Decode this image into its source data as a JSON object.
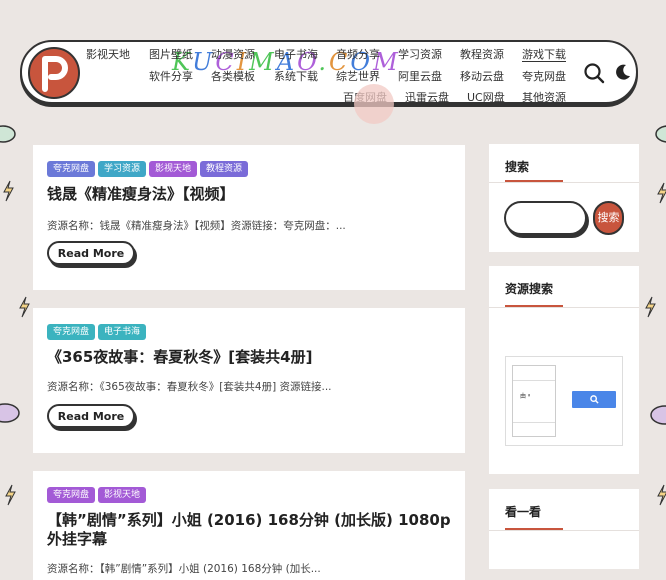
{
  "site": {
    "watermark": [
      "K",
      "U",
      "C",
      "I",
      "M",
      "A",
      "O",
      ".",
      "C",
      "O",
      "M"
    ]
  },
  "nav": {
    "row1": [
      "影视天地",
      "图片壁纸",
      "动漫资源",
      "电子书海",
      "音频分享",
      "学习资源",
      "教程资源",
      "游戏下载"
    ],
    "row2": [
      "软件分享",
      "各类模板",
      "系统下载",
      "综艺世界",
      "阿里云盘",
      "移动云盘",
      "夸克网盘"
    ],
    "row3": [
      "百度网盘",
      "迅雷云盘",
      "UC网盘",
      "其他资源"
    ],
    "active": "游戏下载"
  },
  "colors": {
    "accent": "#c8553d",
    "tag_quark": "#6b79d8",
    "tag_study": "#3fa7c7",
    "tag_video": "#a35ad6",
    "tag_tutorial": "#7a6bd8",
    "tag_ebook": "#3bb3bf"
  },
  "icons": {
    "logo": "p-logo-icon",
    "search": "search-icon",
    "theme": "moon-icon",
    "gcse_search": "magnifier-icon"
  },
  "posts": [
    {
      "tags": [
        "夸克网盘",
        "学习资源",
        "影视天地",
        "教程资源"
      ],
      "title": "钱晟《精准瘦身法》【视频】",
      "excerpt": "资源名称：钱晟《精准瘦身法》【视频】资源链接：夸克网盘：...",
      "read_more": "Read More"
    },
    {
      "tags": [
        "夸克网盘",
        "电子书海"
      ],
      "title": "《365夜故事：春夏秋冬》[套装共4册]",
      "excerpt": "资源名称：《365夜故事：春夏秋冬》[套装共4册] 资源链接...",
      "read_more": "Read More"
    },
    {
      "tags": [
        "夸克网盘",
        "影视天地"
      ],
      "title": "【韩”剧情”系列】小姐 (2016) 168分钟 (加长版) 1080p 外挂字幕",
      "excerpt": "资源名称：【韩”剧情”系列】小姐 (2016) 168分钟 (加长..."
    }
  ],
  "sidebar": {
    "search_title": "搜索",
    "search_button": "搜索",
    "resource_title": "资源搜索",
    "gcse_text": "由 ᵍ",
    "look_title": "看一看"
  }
}
